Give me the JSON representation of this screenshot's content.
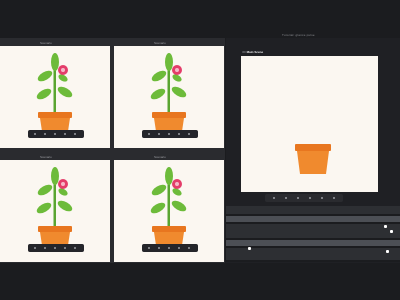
{
  "top_bar": {
    "left_label": "  ",
    "right_label_prefix": "",
    "right_label": "Tutorial: glance pulse"
  },
  "panes": [
    {
      "title": "Scenario"
    },
    {
      "title": "Scenario"
    },
    {
      "title": "Scenario"
    },
    {
      "title": "Scenario"
    }
  ],
  "right_panel": {
    "header_prefix": "3D ",
    "header": "Main Scene"
  },
  "icons": {
    "plant": "potted-flower-icon",
    "pot": "pot-icon",
    "play": "play-icon",
    "rewind": "rewind-icon",
    "forward": "forward-icon",
    "keyframe": "keyframe-icon"
  },
  "colors": {
    "background": "#1b1c1f",
    "canvas": "#fbf7f1",
    "pot": "#f08a2e",
    "pot_rim": "#e8761f",
    "leaf": "#6dbb3a",
    "stem": "#5aa531",
    "flower": "#e43d6a",
    "flower_center": "#f5b8c8"
  }
}
